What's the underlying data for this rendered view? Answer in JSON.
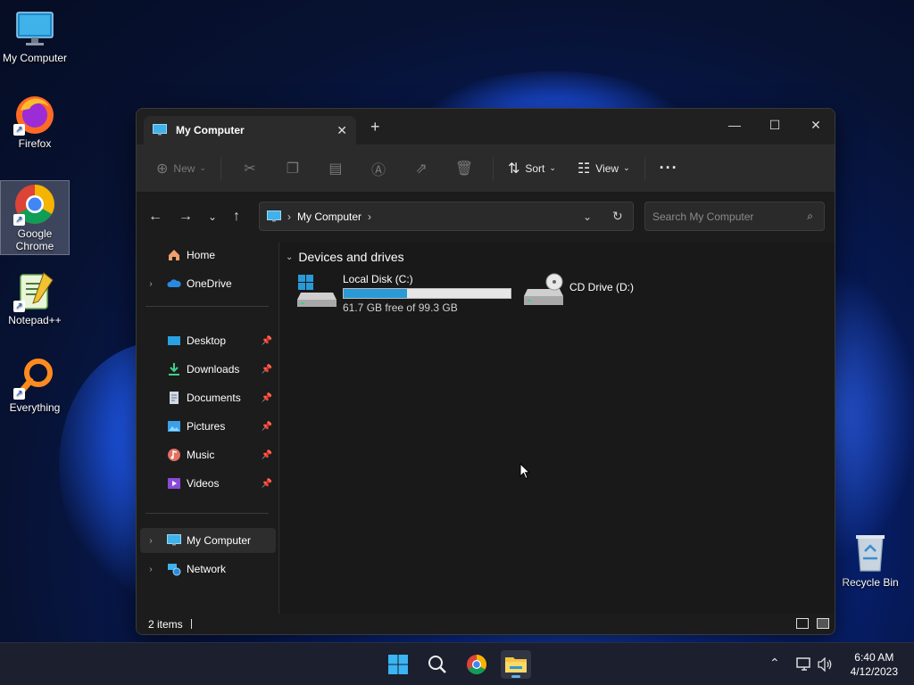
{
  "desktop": {
    "icons": [
      {
        "label": "My Computer"
      },
      {
        "label": "Firefox"
      },
      {
        "label": "Google Chrome"
      },
      {
        "label": "Notepad++"
      },
      {
        "label": "Everything"
      },
      {
        "label": "Recycle Bin"
      }
    ]
  },
  "window": {
    "tab_title": "My Computer",
    "toolbar": {
      "new_label": "New",
      "sort_label": "Sort",
      "view_label": "View"
    },
    "address": {
      "crumbs": [
        "My Computer"
      ]
    },
    "search": {
      "placeholder": "Search My Computer"
    },
    "sidebar": {
      "items": [
        {
          "label": "Home"
        },
        {
          "label": "OneDrive"
        },
        {
          "label": "Desktop"
        },
        {
          "label": "Downloads"
        },
        {
          "label": "Documents"
        },
        {
          "label": "Pictures"
        },
        {
          "label": "Music"
        },
        {
          "label": "Videos"
        },
        {
          "label": "My Computer"
        },
        {
          "label": "Network"
        }
      ]
    },
    "content": {
      "group_label": "Devices and drives",
      "drives": [
        {
          "name": "Local Disk (C:)",
          "usage": "61.7 GB free of 99.3 GB",
          "used_fraction": 0.38
        },
        {
          "name": "CD Drive (D:)"
        }
      ]
    },
    "status": {
      "item_count": "2 items"
    }
  },
  "taskbar": {
    "time": "6:40 AM",
    "date": "4/12/2023"
  },
  "colors": {
    "accent": "#2a9ad7",
    "window_bg": "#1c1c1c"
  }
}
